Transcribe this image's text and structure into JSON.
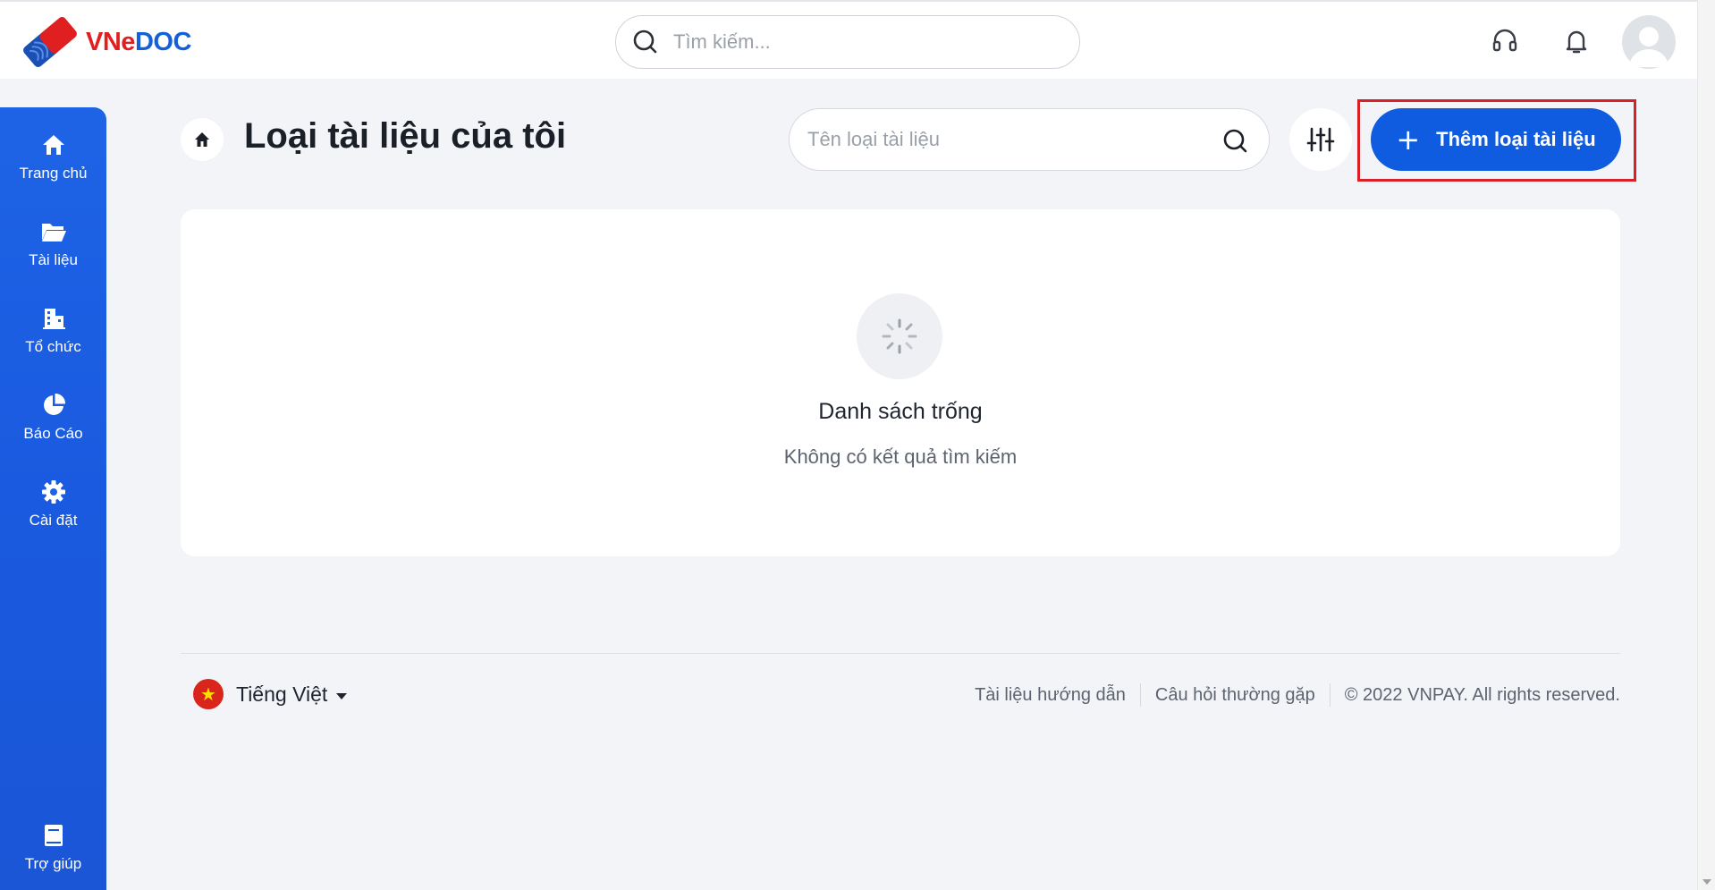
{
  "header": {
    "logo_text_vn": "VN",
    "logo_text_e": "e",
    "logo_text_doc": "DOC",
    "search_placeholder": "Tìm kiếm...",
    "icons": [
      "headset-icon",
      "bell-icon",
      "avatar"
    ]
  },
  "sidebar": {
    "items": [
      {
        "label": "Trang chủ",
        "icon": "home-icon"
      },
      {
        "label": "Tài liệu",
        "icon": "folder-icon"
      },
      {
        "label": "Tổ chức",
        "icon": "building-icon"
      },
      {
        "label": "Báo Cáo",
        "icon": "pie-chart-icon"
      },
      {
        "label": "Cài đặt",
        "icon": "gear-icon"
      }
    ],
    "help": {
      "label": "Trợ giúp",
      "icon": "book-icon"
    }
  },
  "page": {
    "title": "Loại tài liệu của tôi",
    "search_placeholder": "Tên loại tài liệu",
    "add_button_label": "Thêm loại tài liệu"
  },
  "empty_state": {
    "title": "Danh sách trống",
    "subtitle": "Không có kết quả tìm kiếm"
  },
  "footer": {
    "language": "Tiếng Việt",
    "links": [
      "Tài liệu hướng dẫn",
      "Câu hỏi thường gặp"
    ],
    "copyright": "© 2022 VNPAY. All rights reserved."
  },
  "colors": {
    "primary": "#0f5ce0",
    "sidebar": "#1a5ae0",
    "highlight": "#d92027",
    "background": "#f2f4f8"
  }
}
